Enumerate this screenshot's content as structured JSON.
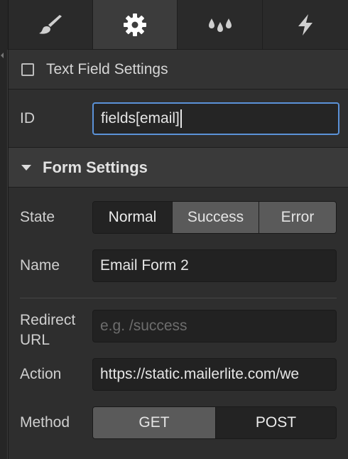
{
  "tabs": [
    {
      "icon": "brush-icon"
    },
    {
      "icon": "gear-icon"
    },
    {
      "icon": "droplets-icon"
    },
    {
      "icon": "lightning-icon"
    }
  ],
  "text_field_settings": {
    "title": "Text Field Settings",
    "id_label": "ID",
    "id_value": "fields[email]"
  },
  "form_settings": {
    "title": "Form Settings",
    "state_label": "State",
    "state_options": [
      "Normal",
      "Success",
      "Error"
    ],
    "state_selected": "Normal",
    "name_label": "Name",
    "name_value": "Email Form 2",
    "redirect_label_line1": "Redirect",
    "redirect_label_line2": "URL",
    "redirect_placeholder": "e.g. /success",
    "action_label": "Action",
    "action_value": "https://static.mailerlite.com/we",
    "method_label": "Method",
    "method_options": [
      "GET",
      "POST"
    ],
    "method_selected": "GET"
  },
  "colors": {
    "focus_border": "#5b92d8",
    "panel_bg": "#2e2e2e"
  }
}
